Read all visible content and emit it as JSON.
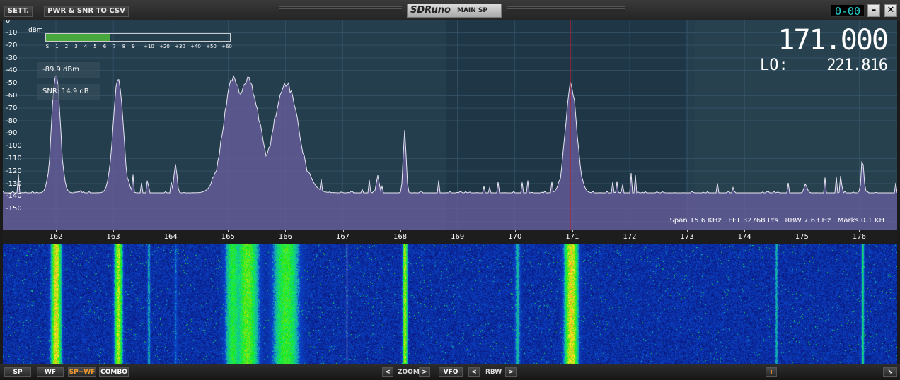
{
  "toolbar": {
    "settings_label": "SETT.",
    "export_label": "PWR & SNR TO CSV",
    "logo_text": "SDRuno",
    "panel_name": "MAIN SP",
    "clock": "0-00",
    "minimize_symbol": "–",
    "close_symbol": "✕"
  },
  "spectrum": {
    "db_labels": [
      "-10",
      "-20",
      "-30",
      "-40",
      "-50",
      "-60",
      "-70",
      "-80",
      "-90",
      "-100",
      "-110",
      "-120",
      "-130",
      "-140",
      "-150"
    ],
    "top_label": "0",
    "smeter": {
      "unit": "dBm",
      "scale": [
        "S",
        "1",
        "2",
        "3",
        "4",
        "5",
        "6",
        "7",
        "8",
        "9",
        "+10",
        "+20",
        "+30",
        "+40",
        "+50",
        "+60"
      ],
      "level_fraction": 0.35
    },
    "power_readout": "-89.9 dBm",
    "snr_readout": "SNR: 14.9 dB",
    "frequency": "171.000",
    "lo_label": "LO:",
    "lo_value": "221.816",
    "info_text": "Span 15.6 KHz   FFT 32768 Pts   RBW 7.63 Hz   Marks 0.1 KH"
  },
  "freq_scale": [
    "162",
    "163",
    "164",
    "165",
    "166",
    "167",
    "168",
    "169",
    "170",
    "171",
    "172",
    "173",
    "174",
    "175",
    "176"
  ],
  "bottom": {
    "sp_label": "SP",
    "wf_label": "WF",
    "spwf_label": "SP+WF",
    "combo_label": "COMBO",
    "zoom_left": "<",
    "zoom_label": "ZOOM",
    "zoom_right": ">",
    "vfo_label": "VFO",
    "rbw_left": "<",
    "rbw_label": "RBW",
    "rbw_right": ">",
    "info_label": "i",
    "resize_symbol": "↘"
  },
  "colors": {
    "spectrum_bg": "#243e4e",
    "trace_fill": "#6a5fa0",
    "vfo_marker": "#c0202a",
    "smeter_fill": "#48a83e",
    "accent_orange": "#f29a2e"
  }
}
